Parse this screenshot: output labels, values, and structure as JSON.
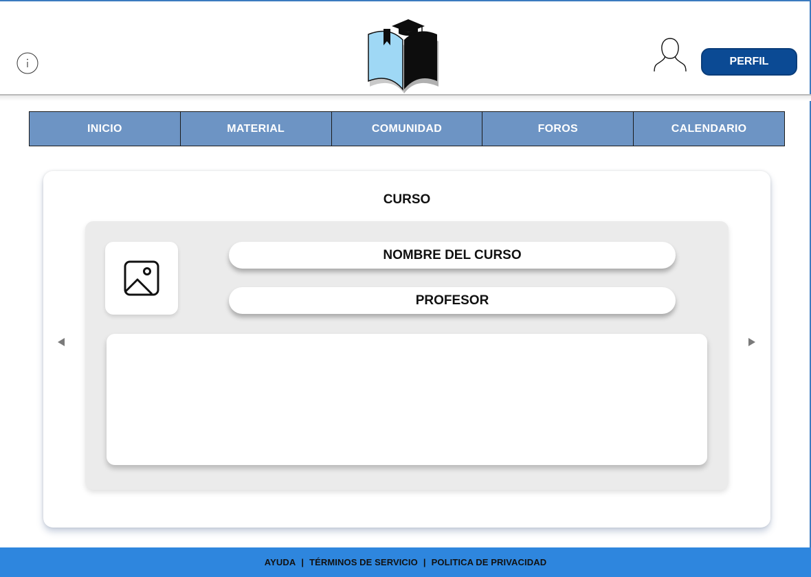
{
  "header": {
    "info_icon": "info-circle-icon",
    "logo_icon": "book-graduation-cap-logo",
    "user_icon": "user-outline-icon",
    "profile_button": "PERFIL"
  },
  "nav": {
    "items": [
      {
        "label": "INICIO"
      },
      {
        "label": "MATERIAL"
      },
      {
        "label": "COMUNIDAD"
      },
      {
        "label": "FOROS"
      },
      {
        "label": "CALENDARIO"
      }
    ]
  },
  "course_card": {
    "title": "CURSO",
    "image_icon": "image-placeholder-icon",
    "course_name": "NOMBRE DEL CURSO",
    "teacher": "PROFESOR",
    "prev_icon": "triangle-left-icon",
    "next_icon": "triangle-right-icon"
  },
  "footer": {
    "links": [
      {
        "label": "AYUDA"
      },
      {
        "label": "TÉRMINOS DE SERVICIO"
      },
      {
        "label": "POLITICA DE PRIVACIDAD"
      }
    ],
    "separator": "|"
  },
  "colors": {
    "accent": "#0b4a94",
    "nav_bg": "#6d94c4",
    "footer_bg": "#2e86de",
    "card_inner": "#ebebeb"
  }
}
